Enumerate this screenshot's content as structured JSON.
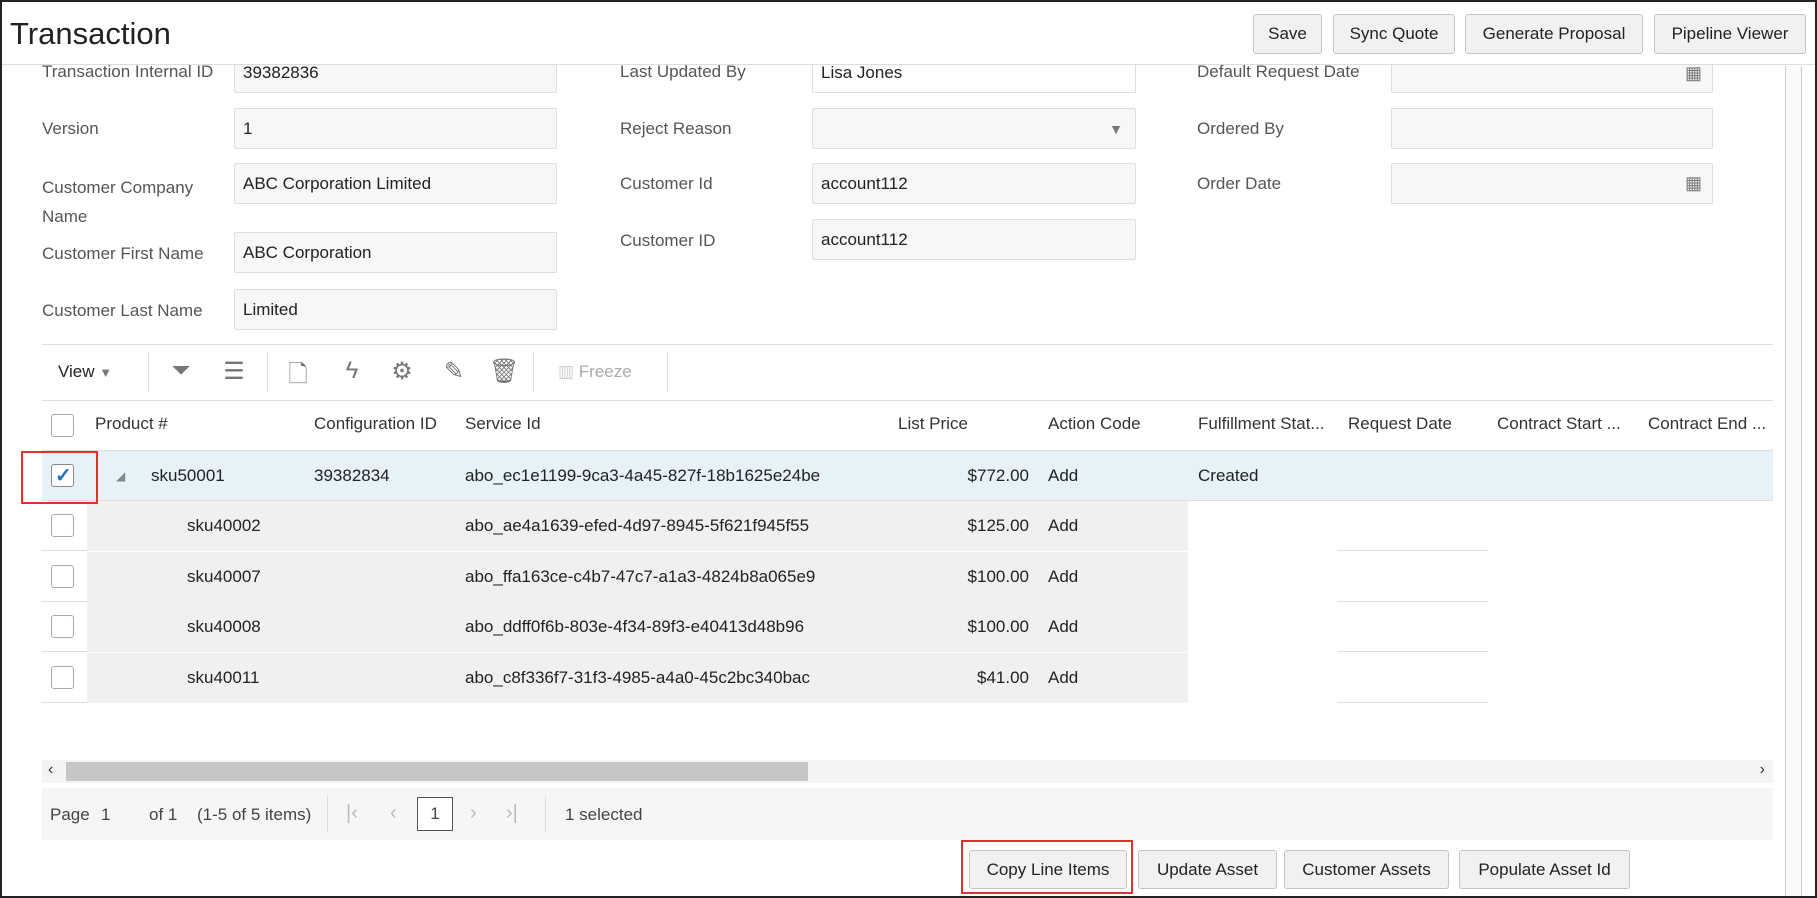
{
  "header": {
    "title": "Transaction",
    "buttons": [
      "Save",
      "Sync Quote",
      "Generate Proposal",
      "Pipeline Viewer"
    ]
  },
  "form": {
    "col1": [
      {
        "label": "Transaction Internal ID",
        "value": "39382836"
      },
      {
        "label": "Version",
        "value": "1"
      },
      {
        "label": "Customer Company Name",
        "value": "ABC Corporation Limited"
      },
      {
        "label": "Customer First Name",
        "value": "ABC Corporation"
      },
      {
        "label": "Customer Last Name",
        "value": "Limited"
      }
    ],
    "col2": [
      {
        "label": "Last Updated By",
        "value": "Lisa Jones"
      },
      {
        "label": "Reject Reason",
        "value": ""
      },
      {
        "label": "Customer Id",
        "value": "account112"
      },
      {
        "label": "Customer ID",
        "value": "account112"
      }
    ],
    "col3": [
      {
        "label": "Default Request Date",
        "value": ""
      },
      {
        "label": "Ordered By",
        "value": ""
      },
      {
        "label": "Order Date",
        "value": ""
      }
    ]
  },
  "toolbar": {
    "view": "View",
    "freeze": "Freeze"
  },
  "table": {
    "columns": [
      "Product #",
      "Configuration ID",
      "Service Id",
      "List Price",
      "Action Code",
      "Fulfillment Stat...",
      "Request Date",
      "Contract Start ...",
      "Contract End ..."
    ],
    "rows": [
      {
        "product": "sku50001",
        "config": "39382834",
        "service": "abo_ec1e1199-9ca3-4a45-827f-18b1625e24be",
        "price": "$772.00",
        "action": "Add",
        "status": "Created",
        "checked": true
      },
      {
        "product": "sku40002",
        "config": "",
        "service": "abo_ae4a1639-efed-4d97-8945-5f621f945f55",
        "price": "$125.00",
        "action": "Add",
        "status": "",
        "checked": false
      },
      {
        "product": "sku40007",
        "config": "",
        "service": "abo_ffa163ce-c4b7-47c7-a1a3-4824b8a065e9",
        "price": "$100.00",
        "action": "Add",
        "status": "",
        "checked": false
      },
      {
        "product": "sku40008",
        "config": "",
        "service": "abo_ddff0f6b-803e-4f34-89f3-e40413d48b96",
        "price": "$100.00",
        "action": "Add",
        "status": "",
        "checked": false
      },
      {
        "product": "sku40011",
        "config": "",
        "service": "abo_c8f336f7-31f3-4985-a4a0-45c2bc340bac",
        "price": "$41.00",
        "action": "Add",
        "status": "",
        "checked": false
      }
    ]
  },
  "pagination": {
    "page_label": "Page",
    "page": "1",
    "of": "of 1",
    "range": "(1-5 of 5 items)",
    "current": "1",
    "selected": "1 selected"
  },
  "actions": [
    "Copy Line Items",
    "Update Asset",
    "Customer Assets",
    "Populate Asset Id"
  ]
}
